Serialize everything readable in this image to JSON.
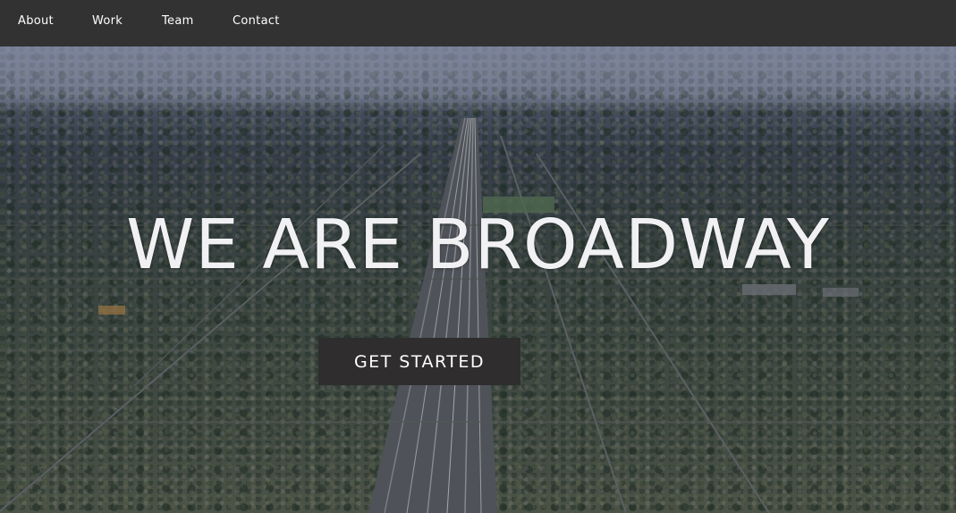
{
  "nav": {
    "items": [
      {
        "label": "About"
      },
      {
        "label": "Work"
      },
      {
        "label": "Team"
      },
      {
        "label": "Contact"
      }
    ]
  },
  "hero": {
    "title": "WE ARE BROADWAY",
    "cta_label": "GET STARTED",
    "background": "aerial-city-freeway-photo"
  },
  "colors": {
    "navbar_bg": "#333232",
    "nav_text": "#ffffff",
    "title_text": "#f1f1f3",
    "button_bg": "#2f2d2d",
    "button_text": "#ffffff"
  }
}
